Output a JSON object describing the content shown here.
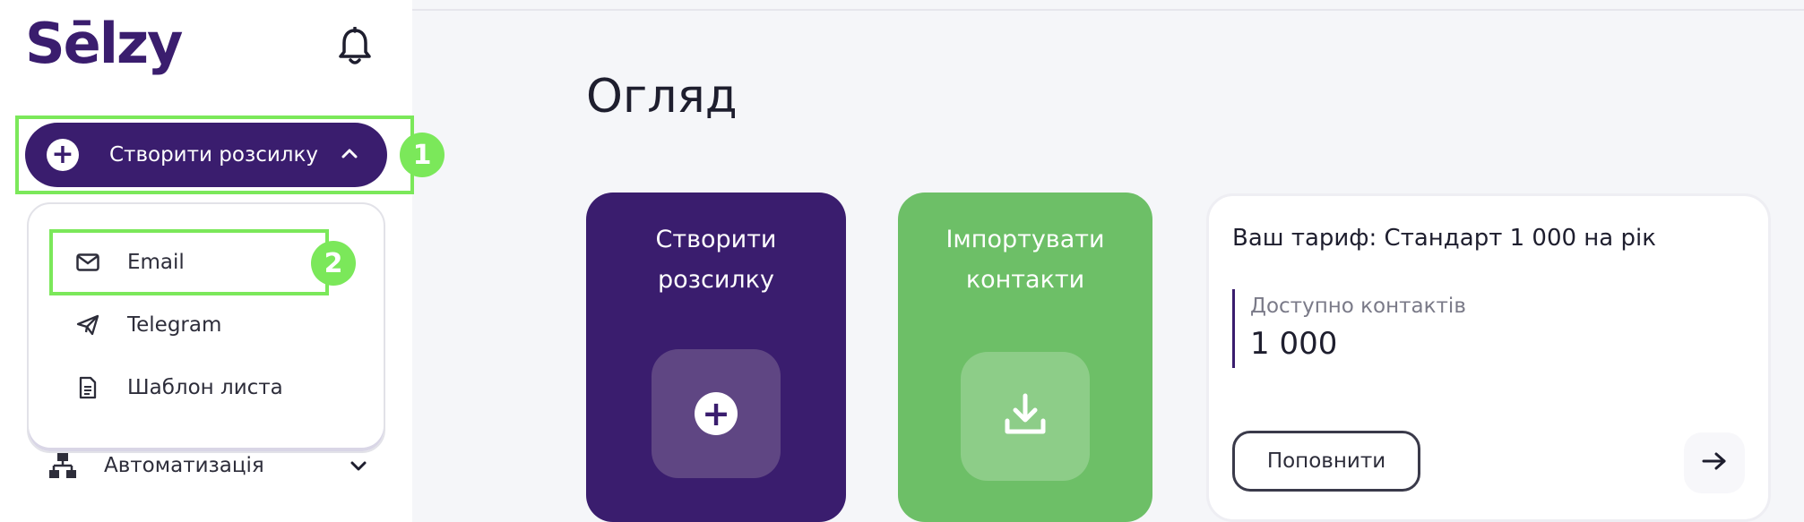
{
  "sidebar": {
    "logo": "Sēlzy",
    "create_button": {
      "label": "Створити розсилку"
    },
    "dropdown": {
      "items": [
        {
          "label": "Email",
          "icon": "envelope-icon"
        },
        {
          "label": "Telegram",
          "icon": "paper-plane-icon"
        },
        {
          "label": "Шаблон листа",
          "icon": "document-icon"
        }
      ]
    },
    "automation": {
      "label": "Автоматизація",
      "icon": "hierarchy-icon"
    }
  },
  "annotations": {
    "step1": "1",
    "step2": "2"
  },
  "main": {
    "title": "Огляд",
    "cards": {
      "create": {
        "title": "Створити розсилку"
      },
      "import": {
        "title": "Імпортувати контакти"
      }
    },
    "tariff": {
      "title": "Ваш тариф: Стандарт 1 000 на рік",
      "contacts_label": "Доступно контактів",
      "contacts_value": "1 000",
      "topup_label": "Поповнити"
    }
  },
  "colors": {
    "brand_purple": "#3a1d6e",
    "green": "#6dbf67",
    "highlight_green": "#7be85a",
    "background": "#f5f6f9"
  }
}
